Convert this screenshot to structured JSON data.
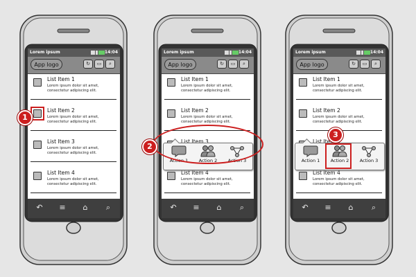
{
  "colors": {
    "highlight": "#cc1f1f",
    "status_bar": "#595959",
    "title_bar": "#8a8a8a",
    "nav_bar": "#3f3f3f",
    "phone_body": "#dcdcdc"
  },
  "status_bar": {
    "title": "Lorem ipsum",
    "time": "14:04"
  },
  "title_bar": {
    "app_logo": "App logo",
    "buttons": [
      {
        "icon": "refresh-icon"
      },
      {
        "icon": "chat-icon"
      },
      {
        "icon": "search-icon"
      }
    ]
  },
  "list": {
    "items": [
      {
        "title": "List Item 1",
        "description": "Lorem ipsum dolor sit amet, consectetur adipiscing elit."
      },
      {
        "title": "List Item 2",
        "description": "Lorem ipsum dolor sit amet, consectetur adipiscing elit."
      },
      {
        "title": "List Item 3",
        "description": "Lorem ipsum dolor sit amet, consectetur adipiscing elit."
      },
      {
        "title": "List Item 4",
        "description": "Lorem ipsum dolor sit amet, consectetur adipiscing elit."
      }
    ]
  },
  "actions": [
    {
      "label": "Action 1",
      "icon": "chat-icon"
    },
    {
      "label": "Action 2",
      "icon": "users-icon"
    },
    {
      "label": "Action 3",
      "icon": "share-icon"
    }
  ],
  "nav_bar": [
    {
      "icon": "back-icon"
    },
    {
      "icon": "menu-icon"
    },
    {
      "icon": "home-icon"
    },
    {
      "icon": "search-icon"
    }
  ],
  "steps": [
    "1",
    "2",
    "3"
  ]
}
